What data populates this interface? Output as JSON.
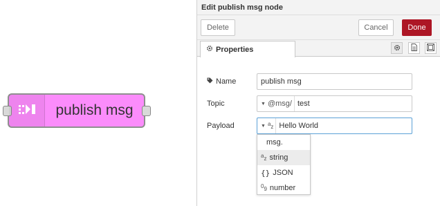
{
  "node": {
    "label": "publish msg",
    "fill_color": "#fb8cfb",
    "icon": "publish-bridge-icon"
  },
  "tray": {
    "title": "Edit publish msg node",
    "buttons": {
      "delete": "Delete",
      "cancel": "Cancel",
      "done": "Done"
    },
    "tabs": [
      {
        "label": "Properties",
        "icon": "gear-icon",
        "active": true
      }
    ],
    "tab_icons": [
      "gear-icon",
      "file-text-icon",
      "appearance-icon"
    ],
    "form": {
      "name": {
        "label": "Name",
        "icon": "tag-icon",
        "value": "publish msg"
      },
      "topic": {
        "label": "Topic",
        "type_prefix": "@msg/",
        "value": "test"
      },
      "payload": {
        "label": "Payload",
        "type_icon": "az-string-icon",
        "value": "Hello World"
      }
    },
    "type_menu": [
      {
        "label": "msg.",
        "icon": ""
      },
      {
        "label": "string",
        "icon": "az-string-icon",
        "hovered": true
      },
      {
        "label": "JSON",
        "icon": "braces-icon"
      },
      {
        "label": "number",
        "icon": "09-number-icon"
      }
    ],
    "accent_color": "#ad1625"
  }
}
